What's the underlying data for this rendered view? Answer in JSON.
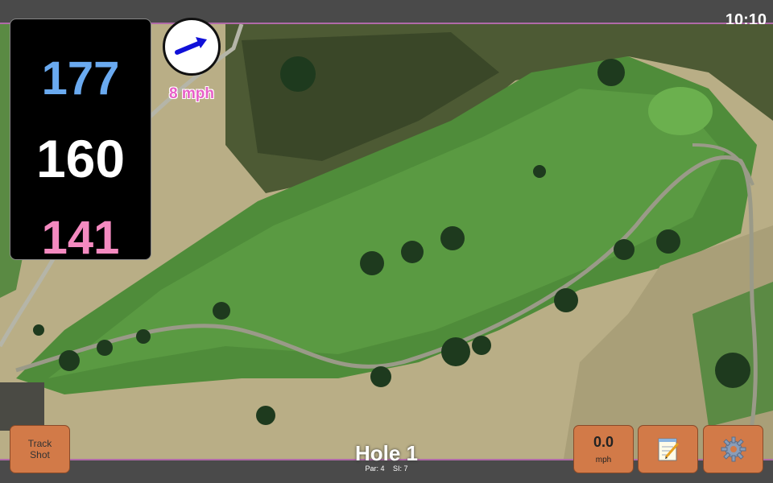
{
  "status": {
    "time": "10:10"
  },
  "distances": {
    "back": "177",
    "middle": "160",
    "front": "141"
  },
  "wind": {
    "speed": "8 mph",
    "arrow_icon": "wind-arrow-icon"
  },
  "hole": {
    "title": "Hole 1",
    "par": "Par: 4",
    "stroke_index": "SI: 7"
  },
  "buttons": {
    "track_shot": "Track\nShot",
    "speed_value": "0.0",
    "speed_unit": "mph",
    "notes_icon": "notepad-icon",
    "settings_icon": "gear-icon"
  },
  "colors": {
    "accent_border": "#b06aa8",
    "button": "#d27a48",
    "back_distance": "#6aaaf0",
    "front_distance": "#f48ac0",
    "wind_text": "#e860c8"
  }
}
